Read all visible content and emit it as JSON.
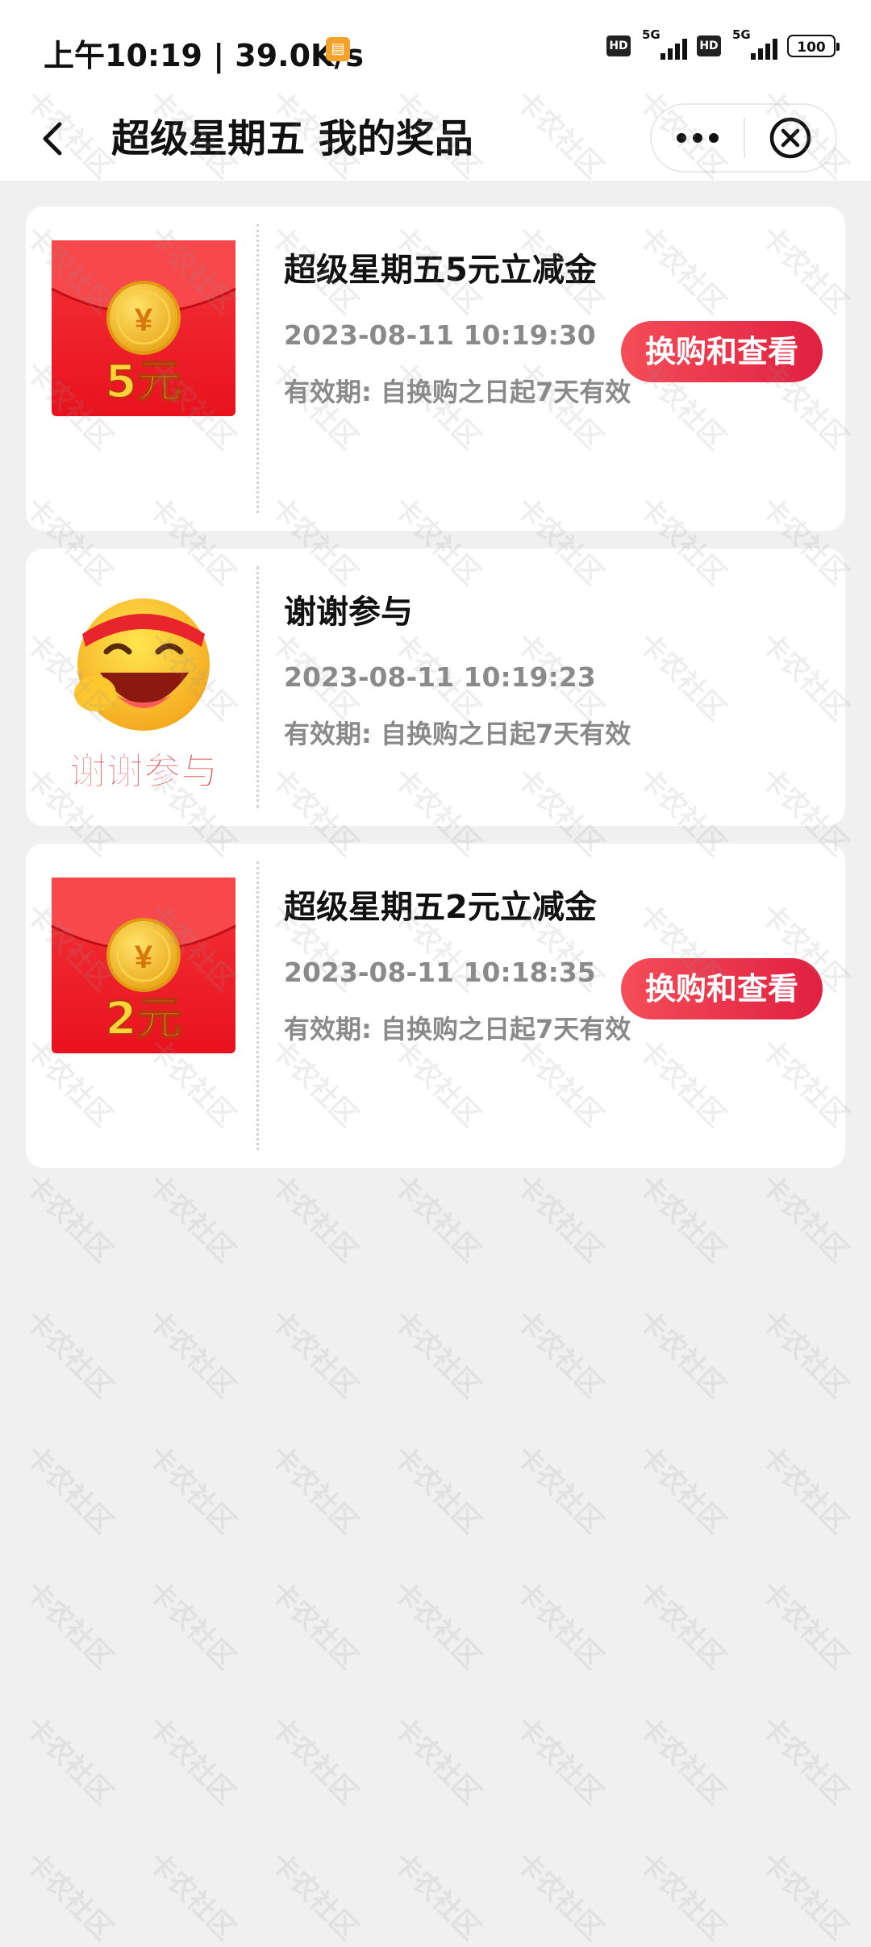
{
  "status_bar": {
    "time_speed": "上午10:19 | 39.0K/s",
    "network": "5G",
    "battery": "100"
  },
  "header": {
    "title": "超级星期五 我的奖品"
  },
  "prizes": [
    {
      "badge": "5元",
      "name": "超级星期五5元立减金",
      "time": "2023-08-11 10:19:30",
      "validity": "有效期: 自换购之日起7天有效",
      "button": "换购和查看"
    },
    {
      "badge": "谢谢参与",
      "name": "谢谢参与",
      "time": "2023-08-11 10:19:23",
      "validity": "有效期: 自换购之日起7天有效"
    },
    {
      "badge": "2元",
      "name": "超级星期五2元立减金",
      "time": "2023-08-11 10:18:35",
      "validity": "有效期: 自换购之日起7天有效",
      "button": "换购和查看"
    }
  ],
  "watermark": "卡农社区",
  "colors": {
    "accent": "#e8344a",
    "envelope_red": "#f0282e",
    "coin_gold": "#f6c232"
  },
  "icons": [
    "back-arrow-icon",
    "more-dots-icon",
    "close-circle-icon",
    "yuan-coin-icon",
    "smiley-icon"
  ]
}
